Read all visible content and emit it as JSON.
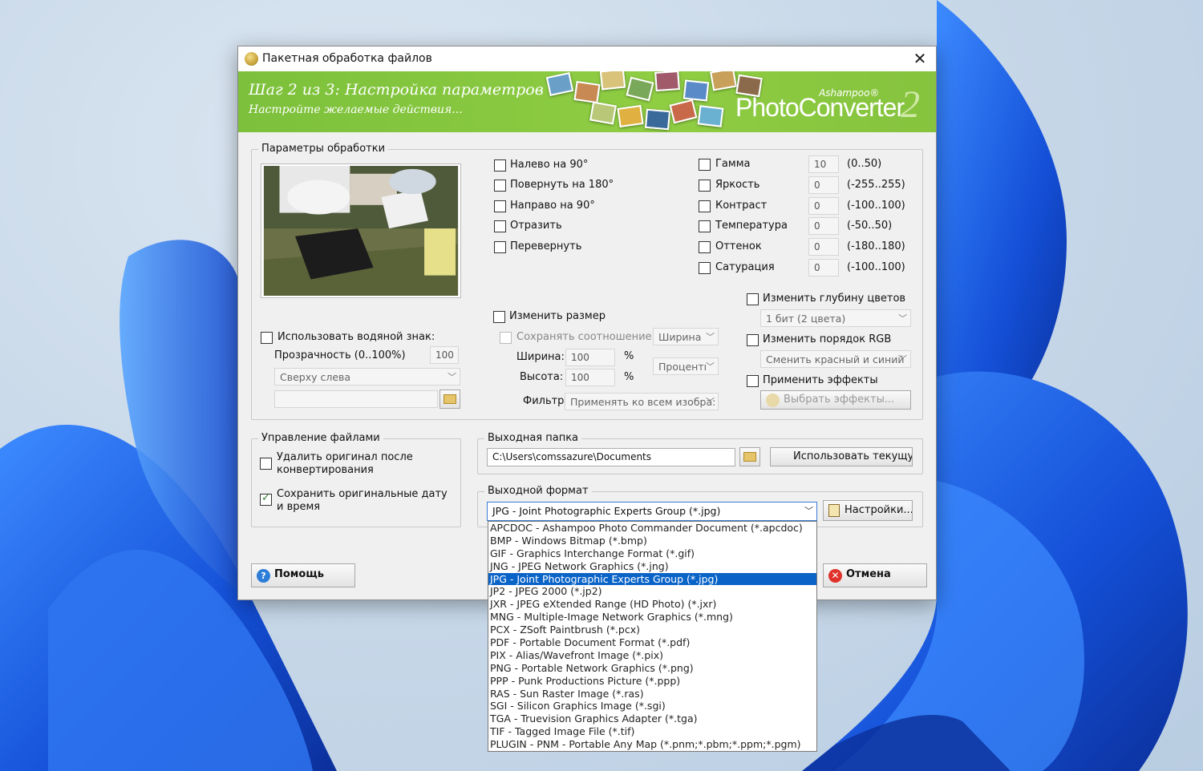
{
  "window": {
    "title": "Пакетная обработка файлов",
    "close_label": "✕"
  },
  "banner": {
    "step": "Шаг 2 из 3: Настройка параметров",
    "subtitle": "Настройте желаемые действия...",
    "brand": "Ashampoo®",
    "product": "PhotoConverter",
    "version": "2"
  },
  "params": {
    "group_title": "Параметры обработки",
    "watermark_label": "Использовать водяной знак:",
    "transparency_label": "Прозрачность (0..100%)",
    "transparency_value": "100",
    "position_value": "Сверху слева",
    "watermark_file": "",
    "rotate": [
      {
        "label": "Налево на 90°"
      },
      {
        "label": "Повернуть на 180°"
      },
      {
        "label": "Направо на 90°"
      },
      {
        "label": "Отразить"
      },
      {
        "label": "Перевернуть"
      }
    ],
    "adjust": [
      {
        "label": "Гамма",
        "value": "10",
        "range": "(0..50)"
      },
      {
        "label": "Яркость",
        "value": "0",
        "range": "(-255..255)"
      },
      {
        "label": "Контраст",
        "value": "0",
        "range": "(-100..100)"
      },
      {
        "label": "Температура",
        "value": "0",
        "range": "(-50..50)"
      },
      {
        "label": "Оттенок",
        "value": "0",
        "range": "(-180..180)"
      },
      {
        "label": "Сатурация",
        "value": "0",
        "range": "(-100..100)"
      }
    ],
    "resize_label": "Изменить размер",
    "keep_ratio_label": "Сохранять соотношение",
    "ratio_combo": "Ширина",
    "width_label": "Ширина:",
    "width_value": "100",
    "width_unit": "%",
    "height_label": "Высота:",
    "height_value": "100",
    "height_unit": "%",
    "units_combo": "Процентı",
    "filter_label": "Фильтр",
    "filter_value": "Применять ко всем изобра:",
    "depth_label": "Изменить глубину цветов",
    "depth_value": "1 бит (2 цвета)",
    "rgb_label": "Изменить порядок RGB",
    "rgb_value": "Сменить красный и синий",
    "effects_label": "Применить эффекты",
    "effects_button": "Выбрать эффекты..."
  },
  "files": {
    "group_title": "Управление файлами",
    "delete_original": "Удалить оригинал после конвертирования",
    "keep_dates": "Сохранить оригинальные дату и время"
  },
  "output_folder": {
    "group_title": "Выходная папка",
    "path": "C:\\Users\\comssazure\\Documents",
    "use_current_button": "Использовать текущую"
  },
  "output_format": {
    "group_title": "Выходной формат",
    "selected": "JPG - Joint Photographic Experts Group (*.jpg)",
    "settings_button": "Настройки...",
    "options": [
      "APCDOC - Ashampoo Photo Commander Document (*.apcdoc)",
      "BMP - Windows Bitmap (*.bmp)",
      "GIF - Graphics Interchange Format (*.gif)",
      "JNG - JPEG Network Graphics (*.jng)",
      "JPG - Joint Photographic Experts Group (*.jpg)",
      "JP2 - JPEG 2000 (*.jp2)",
      "JXR - JPEG eXtended Range (HD Photo) (*.jxr)",
      "MNG - Multiple-Image Network Graphics (*.mng)",
      "PCX - ZSoft Paintbrush (*.pcx)",
      "PDF - Portable Document Format (*.pdf)",
      "PIX - Alias/Wavefront Image (*.pix)",
      "PNG - Portable Network Graphics (*.png)",
      "PPP - Punk Productions Picture (*.ppp)",
      "RAS - Sun Raster Image (*.ras)",
      "SGI - Silicon Graphics Image (*.sgi)",
      "TGA - Truevision Graphics Adapter (*.tga)",
      "TIF - Tagged Image File (*.tif)",
      "PLUGIN - PNM - Portable Any Map (*.pnm;*.pbm;*.ppm;*.pgm)"
    ],
    "selected_index": 4
  },
  "footer": {
    "help_button": "Помощь",
    "cancel_button": "Отмена"
  },
  "colors": {
    "banner_green": "#8fcd43",
    "selection_blue": "#0a64c8",
    "wallpaper_blue": "#1f5fe0"
  }
}
